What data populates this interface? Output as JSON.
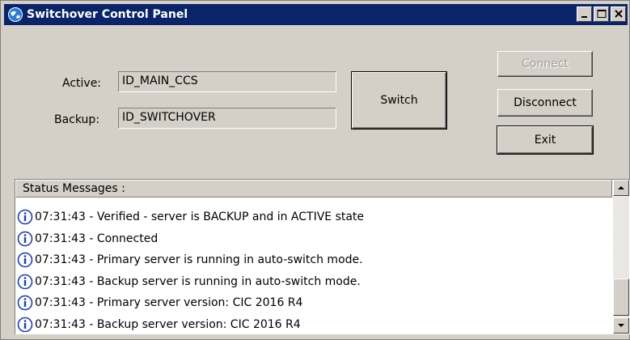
{
  "window": {
    "title": "Switchover Control Panel",
    "icon": "app-globe-icon",
    "controls": [
      "minimize-icon",
      "maximize-icon",
      "close-icon"
    ]
  },
  "form": {
    "active_label": "Active:",
    "active_value": "ID_MAIN_CCS",
    "backup_label": "Backup:",
    "backup_value": "ID_SWITCHOVER"
  },
  "buttons": {
    "switch": "Switch",
    "connect": "Connect",
    "disconnect": "Disconnect",
    "exit": "Exit"
  },
  "status": {
    "header": "Status Messages :",
    "messages": [
      "07:31:43 - Verified - server is BACKUP and in ACTIVE state",
      "07:31:43 - Connected",
      "07:31:43 - Primary server is running in auto-switch mode.",
      "07:31:43 - Backup server is running in auto-switch mode.",
      "07:31:43 - Primary server version: CIC 2016 R4",
      "07:31:43 - Backup server version: CIC 2016 R4"
    ],
    "message_icon": "info-icon"
  },
  "colors": {
    "titlebar": "#0a246a",
    "face": "#d4d0c8",
    "info_icon": "#1d3fbf"
  }
}
